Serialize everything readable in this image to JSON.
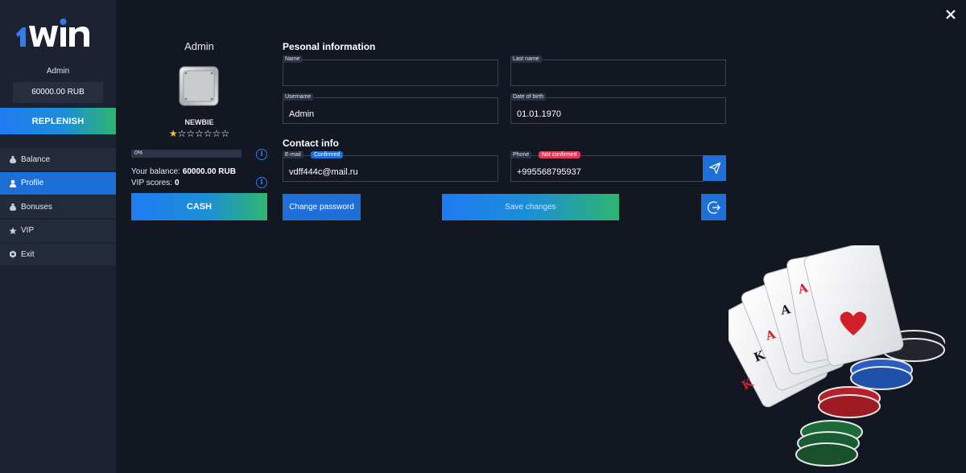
{
  "sidebar": {
    "username": "Admin",
    "balance": "60000.00 RUB",
    "replenish_label": "REPLENISH",
    "menu": [
      {
        "label": "Balance",
        "icon": "money-bag-icon",
        "active": false
      },
      {
        "label": "Profile",
        "icon": "user-icon",
        "active": true
      },
      {
        "label": "Bonuses",
        "icon": "money-bag-icon",
        "active": false
      },
      {
        "label": "VIP",
        "icon": "star-icon",
        "active": false
      },
      {
        "label": "Exit",
        "icon": "exit-icon",
        "active": false
      }
    ]
  },
  "profile": {
    "name": "Admin",
    "rank": "NEWBIE",
    "stars_filled": 1,
    "stars_total": 7,
    "progress_label": "0%",
    "progress_fraction": 0.0,
    "balance_label": "Your balance:",
    "balance_value": "60000.00 RUB",
    "vip_label": "VIP scores:",
    "vip_value": "0",
    "cash_label": "CASH"
  },
  "personal": {
    "title": "Pesonal information",
    "name_label": "Name",
    "name_value": "",
    "lastname_label": "Last name",
    "lastname_value": "",
    "username_label": "Username",
    "username_value": "Admin",
    "dob_label": "Date of birth",
    "dob_value": "01.01.1970"
  },
  "contact": {
    "title": "Contact info",
    "email_label": "E-mail",
    "email_status": "Confirmed",
    "email_value": "vdff444c@mail.ru",
    "phone_label": "Phone",
    "phone_status": "Not confirmed",
    "phone_value": "+995568795937"
  },
  "actions": {
    "change_password": "Change password",
    "save_changes": "Save changes"
  },
  "colors": {
    "background": "#131722",
    "sidebar": "#1c2231",
    "accent_blue": "#1f6fd8",
    "accent_green": "#2eb56f",
    "confirmed": "#1f6fd8",
    "not_confirmed": "#e03a58",
    "star": "#f2c230"
  }
}
